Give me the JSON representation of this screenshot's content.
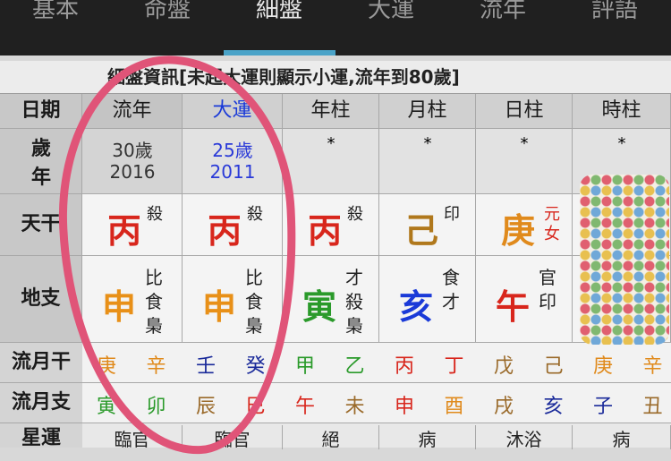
{
  "tabs": [
    "基本",
    "命盤",
    "細盤",
    "大運",
    "流年",
    "評語"
  ],
  "banner": "細盤資訊[未起大運則顯示小運,流年到80歲]",
  "header": {
    "label": "日期",
    "cols": [
      "流年",
      "大運",
      "年柱",
      "月柱",
      "日柱",
      "時柱"
    ],
    "dayun_color": "#1a3ad8"
  },
  "age_row": {
    "label_top": "歲",
    "label_bottom": "年",
    "liunian": {
      "age": "30歲",
      "year": "2016"
    },
    "dayun": {
      "age": "25歲",
      "year": "2011"
    },
    "others": [
      "*",
      "*",
      "*",
      "*"
    ]
  },
  "tiangan": {
    "label": "天干",
    "cells": [
      {
        "char": "丙",
        "god": "殺",
        "color": "#d8261c"
      },
      {
        "char": "丙",
        "god": "殺",
        "color": "#d8261c"
      },
      {
        "char": "丙",
        "god": "殺",
        "color": "#d8261c"
      },
      {
        "char": "己",
        "god": "印",
        "color": "#b0781c"
      },
      {
        "char": "庚",
        "god": "元女",
        "color": "#e08a1c"
      }
    ]
  },
  "dizhi": {
    "label": "地支",
    "cells": [
      {
        "char": "申",
        "gods": [
          "比",
          "食",
          "梟"
        ],
        "color": "#e89018"
      },
      {
        "char": "申",
        "gods": [
          "比",
          "食",
          "梟"
        ],
        "color": "#e89018"
      },
      {
        "char": "寅",
        "gods": [
          "才",
          "殺",
          "梟"
        ],
        "color": "#2a9a2a"
      },
      {
        "char": "亥",
        "gods": [
          "食",
          "才"
        ],
        "color": "#1a3ad8"
      },
      {
        "char": "午",
        "gods": [
          "官",
          "印"
        ],
        "color": "#d8261c"
      }
    ]
  },
  "liuyue_gan": {
    "label": "流月干",
    "items": [
      {
        "t": "庚",
        "c": "#e08a1c"
      },
      {
        "t": "辛",
        "c": "#e08a1c"
      },
      {
        "t": "壬",
        "c": "#1a2a9a"
      },
      {
        "t": "癸",
        "c": "#1a2a9a"
      },
      {
        "t": "甲",
        "c": "#2a9a2a"
      },
      {
        "t": "乙",
        "c": "#2a9a2a"
      },
      {
        "t": "丙",
        "c": "#d8261c"
      },
      {
        "t": "丁",
        "c": "#d8261c"
      },
      {
        "t": "戊",
        "c": "#9a6a2a"
      },
      {
        "t": "己",
        "c": "#9a6a2a"
      },
      {
        "t": "庚",
        "c": "#e08a1c"
      },
      {
        "t": "辛",
        "c": "#e08a1c"
      }
    ]
  },
  "liuyue_zhi": {
    "label": "流月支",
    "items": [
      {
        "t": "寅",
        "c": "#2a9a2a"
      },
      {
        "t": "卯",
        "c": "#2a9a2a"
      },
      {
        "t": "辰",
        "c": "#9a6a2a"
      },
      {
        "t": "巳",
        "c": "#d8261c"
      },
      {
        "t": "午",
        "c": "#d8261c"
      },
      {
        "t": "未",
        "c": "#9a6a2a"
      },
      {
        "t": "申",
        "c": "#d8261c"
      },
      {
        "t": "酉",
        "c": "#e08a1c"
      },
      {
        "t": "戌",
        "c": "#9a6a2a"
      },
      {
        "t": "亥",
        "c": "#1a2a9a"
      },
      {
        "t": "子",
        "c": "#1a2a9a"
      },
      {
        "t": "丑",
        "c": "#9a6a2a"
      }
    ]
  },
  "xingyun": {
    "label": "星運",
    "cells": [
      "臨官",
      "臨官",
      "絕",
      "病",
      "沐浴",
      "病"
    ]
  }
}
